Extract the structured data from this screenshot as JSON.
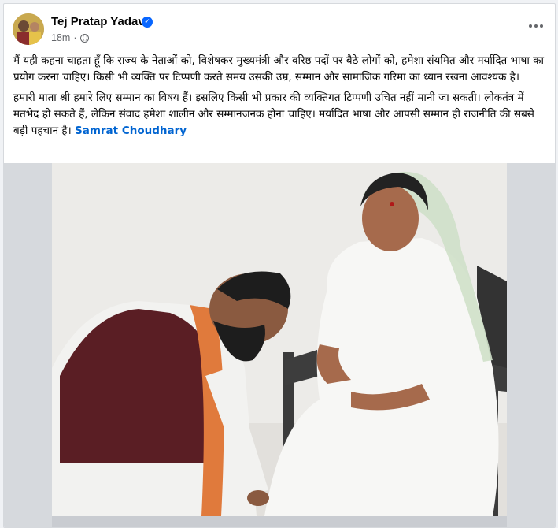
{
  "post": {
    "author": "Tej Pratap Yadav",
    "time": "18m",
    "paragraph1": "मैं यही कहना चाहता हूँ कि राज्य के नेताओं को, विशेषकर मुख्यमंत्री और वरिष्ठ पदों पर बैठे लोगों को, हमेशा संयमित और मर्यादित भाषा का प्रयोग करना चाहिए। किसी भी व्यक्ति पर टिप्पणी करते समय उसकी उम्र, सम्मान और सामाजिक गरिमा का ध्यान रखना आवश्यक है।",
    "paragraph2": "हमारी माता श्री हमारे लिए सम्मान का विषय हैं। इसलिए किसी भी प्रकार की व्यक्तिगत टिप्पणी उचित नहीं मानी जा सकती। लोकतंत्र में मतभेद हो सकते हैं, लेकिन संवाद हमेशा शालीन और सम्मानजनक होना चाहिए। मर्यादित भाषा और आपसी सम्मान ही राजनीति की सबसे बड़ी पहचान है।",
    "mention": "Samrat Choudhary"
  },
  "icons": {
    "verified": "verified-badge-icon",
    "privacy": "globe-icon",
    "more": "more-options-icon"
  },
  "colors": {
    "verified": "#0866ff",
    "mention": "#0064d1",
    "meta": "#65676b"
  }
}
